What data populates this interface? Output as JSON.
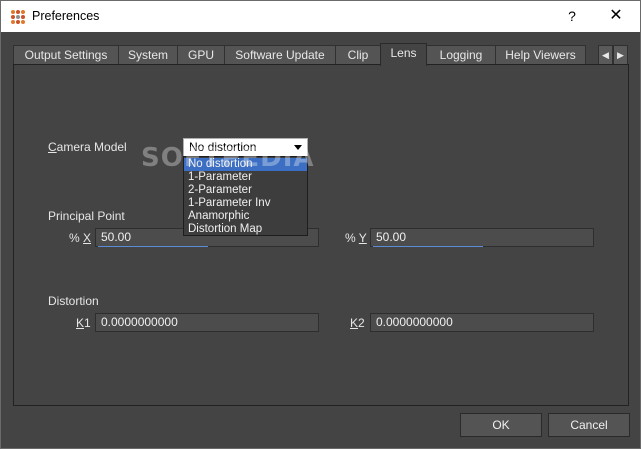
{
  "window": {
    "title": "Preferences",
    "help_glyph": "?",
    "close_glyph": "✕"
  },
  "tabs": [
    {
      "label": "Output Settings"
    },
    {
      "label": "System"
    },
    {
      "label": "GPU"
    },
    {
      "label": "Software Update"
    },
    {
      "label": "Clip"
    },
    {
      "label": "Lens",
      "active": true
    },
    {
      "label": "Logging"
    },
    {
      "label": "Help Viewers"
    }
  ],
  "tab_scroll": {
    "left_glyph": "◀",
    "right_glyph": "▶"
  },
  "camera_model": {
    "label_underlined": "C",
    "label_rest": "amera Model",
    "selected": "No distortion",
    "options": [
      "No distortion",
      "1-Parameter",
      "2-Parameter",
      "1-Parameter Inv",
      "Anamorphic",
      "Distortion Map"
    ]
  },
  "principal_point": {
    "section_label": "Principal Point",
    "x_prefix": "% ",
    "x_underlined": "X",
    "x_value": "50.00",
    "y_prefix": "% ",
    "y_underlined": "Y",
    "y_value": "50.00"
  },
  "distortion": {
    "section_label": "Distortion",
    "k1_underlined": "K",
    "k1_rest": "1",
    "k1_value": "0.0000000000",
    "k2_underlined": "K",
    "k2_rest": "2",
    "k2_value": "0.0000000000"
  },
  "buttons": {
    "ok": "OK",
    "cancel": "Cancel"
  },
  "watermark": "SOFTPEDIA",
  "colors": {
    "panel_bg": "#444444",
    "selection": "#3c6fc3",
    "focus_line": "#5b8bd6"
  }
}
